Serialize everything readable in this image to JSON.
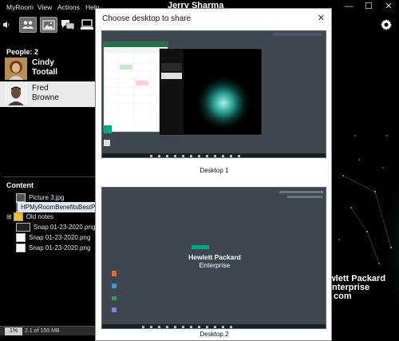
{
  "window": {
    "title": "Jerry Sharma",
    "menu": [
      "MyRoom",
      "View",
      "Actions",
      "Help"
    ],
    "controls": {
      "minimize": "—",
      "maximize": "☐",
      "close": "✕"
    }
  },
  "toolbar": {
    "icons": [
      "speaker-icon",
      "people-icon",
      "picture-icon",
      "chat-icon",
      "desktop-icon"
    ],
    "settings_icon": "gear-icon"
  },
  "people": {
    "title": "People: 2",
    "list": [
      {
        "first": "Cindy",
        "last": "Tootall",
        "selected": false
      },
      {
        "first": "Fred",
        "last": "Browne",
        "selected": true
      }
    ]
  },
  "content": {
    "title": "Content",
    "files": [
      {
        "name": "Picture 3.jpg",
        "type": "image"
      },
      {
        "name": "HPMyRoomBenefitsBestPra",
        "type": "document",
        "selected": true
      },
      {
        "name": "Old notes",
        "type": "folder",
        "expander": "⊞"
      },
      {
        "name": "Snap 01-23-2020.png",
        "type": "image"
      },
      {
        "name": "Snap 01-23-2020.png",
        "type": "image"
      },
      {
        "name": "Snap 01-23-2020.png",
        "type": "image"
      }
    ]
  },
  "status": {
    "percent": "1%",
    "usage": "2.1 of 150 MB"
  },
  "background": {
    "brand_lines": [
      "ewlett Packard",
      "nterprise",
      "com"
    ]
  },
  "dialog": {
    "title": "Choose desktop to share",
    "close": "✕",
    "desktops": [
      {
        "label": "Desktop 1"
      },
      {
        "label": "Desktop 2",
        "brand": [
          "Hewlett Packard",
          "Enterprise"
        ]
      }
    ]
  },
  "colors": {
    "dialog_bg": "#ffffff",
    "app_bg": "#000000",
    "desktop_bg": "#3e464f",
    "hpe_green": "#01a982"
  }
}
